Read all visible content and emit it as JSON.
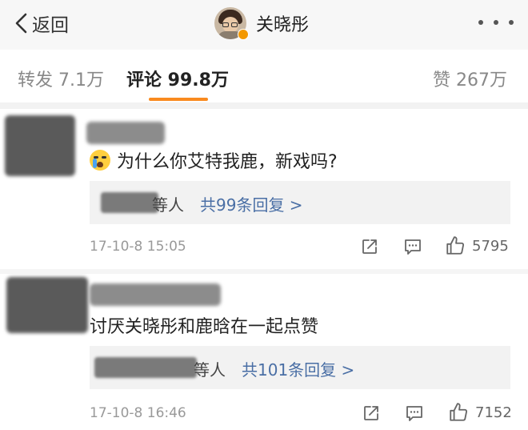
{
  "header": {
    "back_label": "返回",
    "username": "关晓彤"
  },
  "tabs": {
    "repost": "转发 7.1万",
    "comment": "评论 99.8万",
    "like": "赞 267万"
  },
  "accent_color": "#f98a1f",
  "link_color": "#4a6fa5",
  "comments": [
    {
      "emoji": "crying-face-icon",
      "text": "为什么你艾特我鹿，新戏吗?",
      "reply_people": "等人",
      "reply_link": "共99条回复 >",
      "time": "17-10-8 15:05",
      "likes": "5795"
    },
    {
      "text": "讨厌关晓彤和鹿晗在一起点赞",
      "reply_people": "等人",
      "reply_link": "共101条回复 >",
      "time": "17-10-8 16:46",
      "likes": "7152"
    }
  ]
}
